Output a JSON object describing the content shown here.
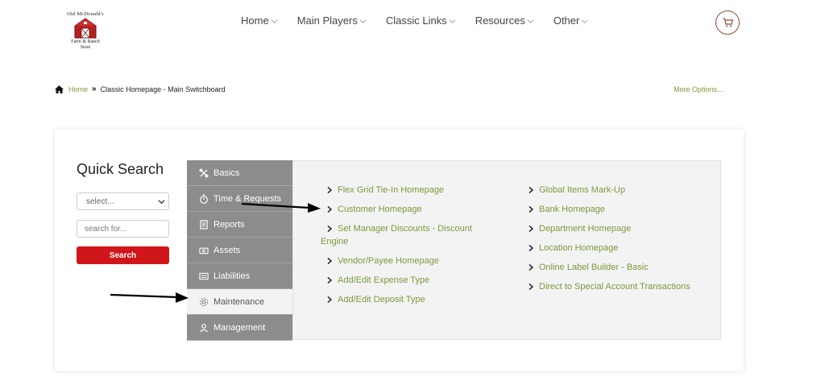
{
  "logo": {
    "top_text": "Old McDonald's",
    "bottom_line1": "Farm & Ranch",
    "bottom_line2": "Store"
  },
  "nav": {
    "items": [
      {
        "label": "Home"
      },
      {
        "label": "Main Players"
      },
      {
        "label": "Classic Links"
      },
      {
        "label": "Resources"
      },
      {
        "label": "Other"
      }
    ]
  },
  "breadcrumb": {
    "home": "Home",
    "current": "Classic Homepage - Main Switchboard",
    "more_options": "More Options..."
  },
  "quick_search": {
    "title": "Quick Search",
    "select_value": "select...",
    "input_placeholder": "search for...",
    "button_label": "Search"
  },
  "menu": {
    "items": [
      {
        "label": "Basics",
        "icon": "tools-icon"
      },
      {
        "label": "Time & Requests",
        "icon": "stopwatch-icon"
      },
      {
        "label": "Reports",
        "icon": "report-icon"
      },
      {
        "label": "Assets",
        "icon": "money-icon"
      },
      {
        "label": "Liabilities",
        "icon": "list-icon"
      },
      {
        "label": "Maintenance",
        "icon": "gear-icon"
      },
      {
        "label": "Management",
        "icon": "user-icon"
      }
    ],
    "active": "Maintenance"
  },
  "links": {
    "col1": [
      "Flex Grid Tie-In Homepage",
      "Customer Homepage",
      "Set Manager Discounts - Discount Engine",
      "Vendor/Payee Homepage",
      "Add/Edit Expense Type",
      "Add/Edit Deposit Type"
    ],
    "col2": [
      "Global Items Mark-Up",
      "Bank Homepage",
      "Department Homepage",
      "Location Homepage",
      "Online Label Builder - Basic",
      "Direct to Special Account Transactions"
    ]
  },
  "colors": {
    "accent_green": "#7a9a3a",
    "search_red": "#d0161b",
    "menu_gray": "#8c8c8c"
  }
}
